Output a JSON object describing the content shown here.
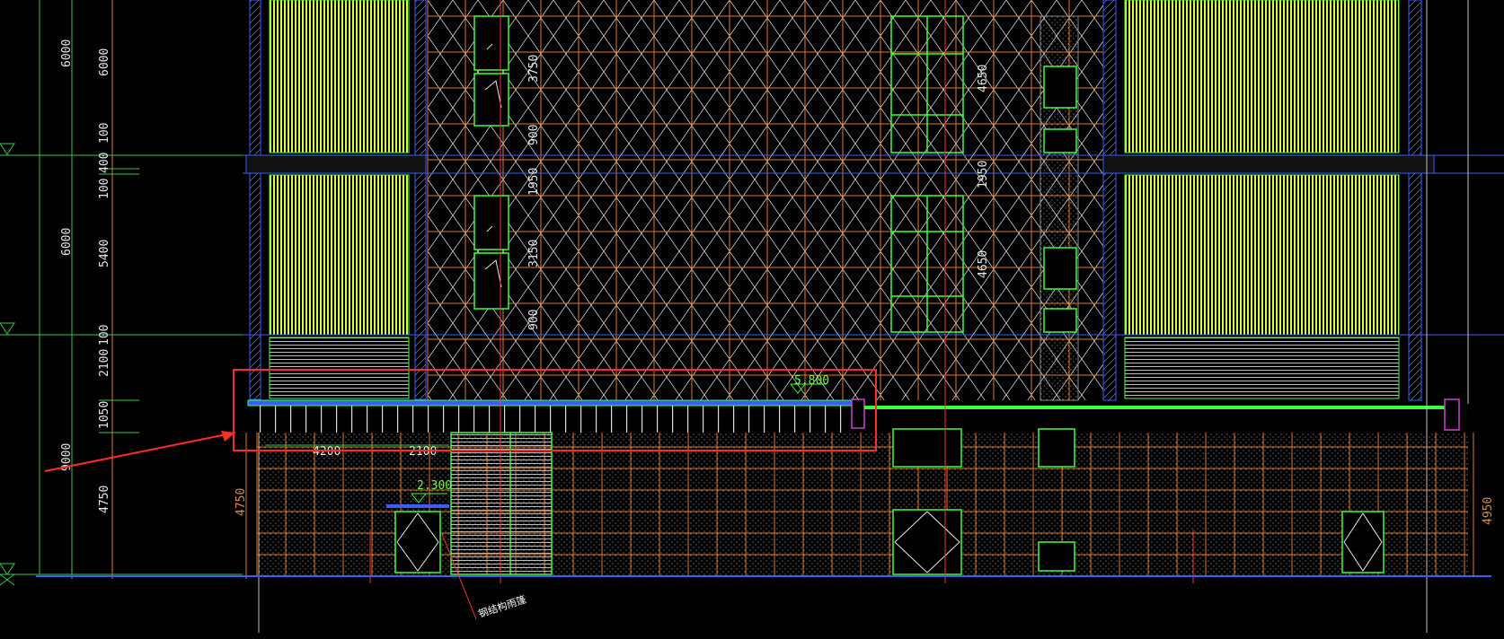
{
  "drawing": {
    "background": "#000000",
    "colors": {
      "grid_orange": "#e07a2a",
      "window_green": "#3cff3c",
      "panel_yellow": "#d8ff3a",
      "wall_blue": "#3a5cff",
      "highlight_red": "#ff2a2a",
      "axis_red": "#ff3030",
      "dim_green": "#35c94a",
      "magenta": "#d040d0"
    }
  },
  "dimensions": {
    "left_outer": [
      "6000",
      "6000",
      "9000"
    ],
    "left_inner": [
      "6000",
      "100",
      "400",
      "100",
      "5400",
      "100",
      "2100",
      "1050",
      "4750"
    ],
    "left_orange": "4750",
    "right_orange": "4950",
    "center_left": [
      "3750",
      "900",
      "1950",
      "3150",
      "900"
    ],
    "center_right": [
      "4650",
      "1950",
      "4650"
    ],
    "bottom": [
      "4200",
      "2100"
    ]
  },
  "levels": {
    "canopy": "5.800",
    "entrance": "2.300"
  },
  "annotation": {
    "text": "钢结构雨篷"
  }
}
